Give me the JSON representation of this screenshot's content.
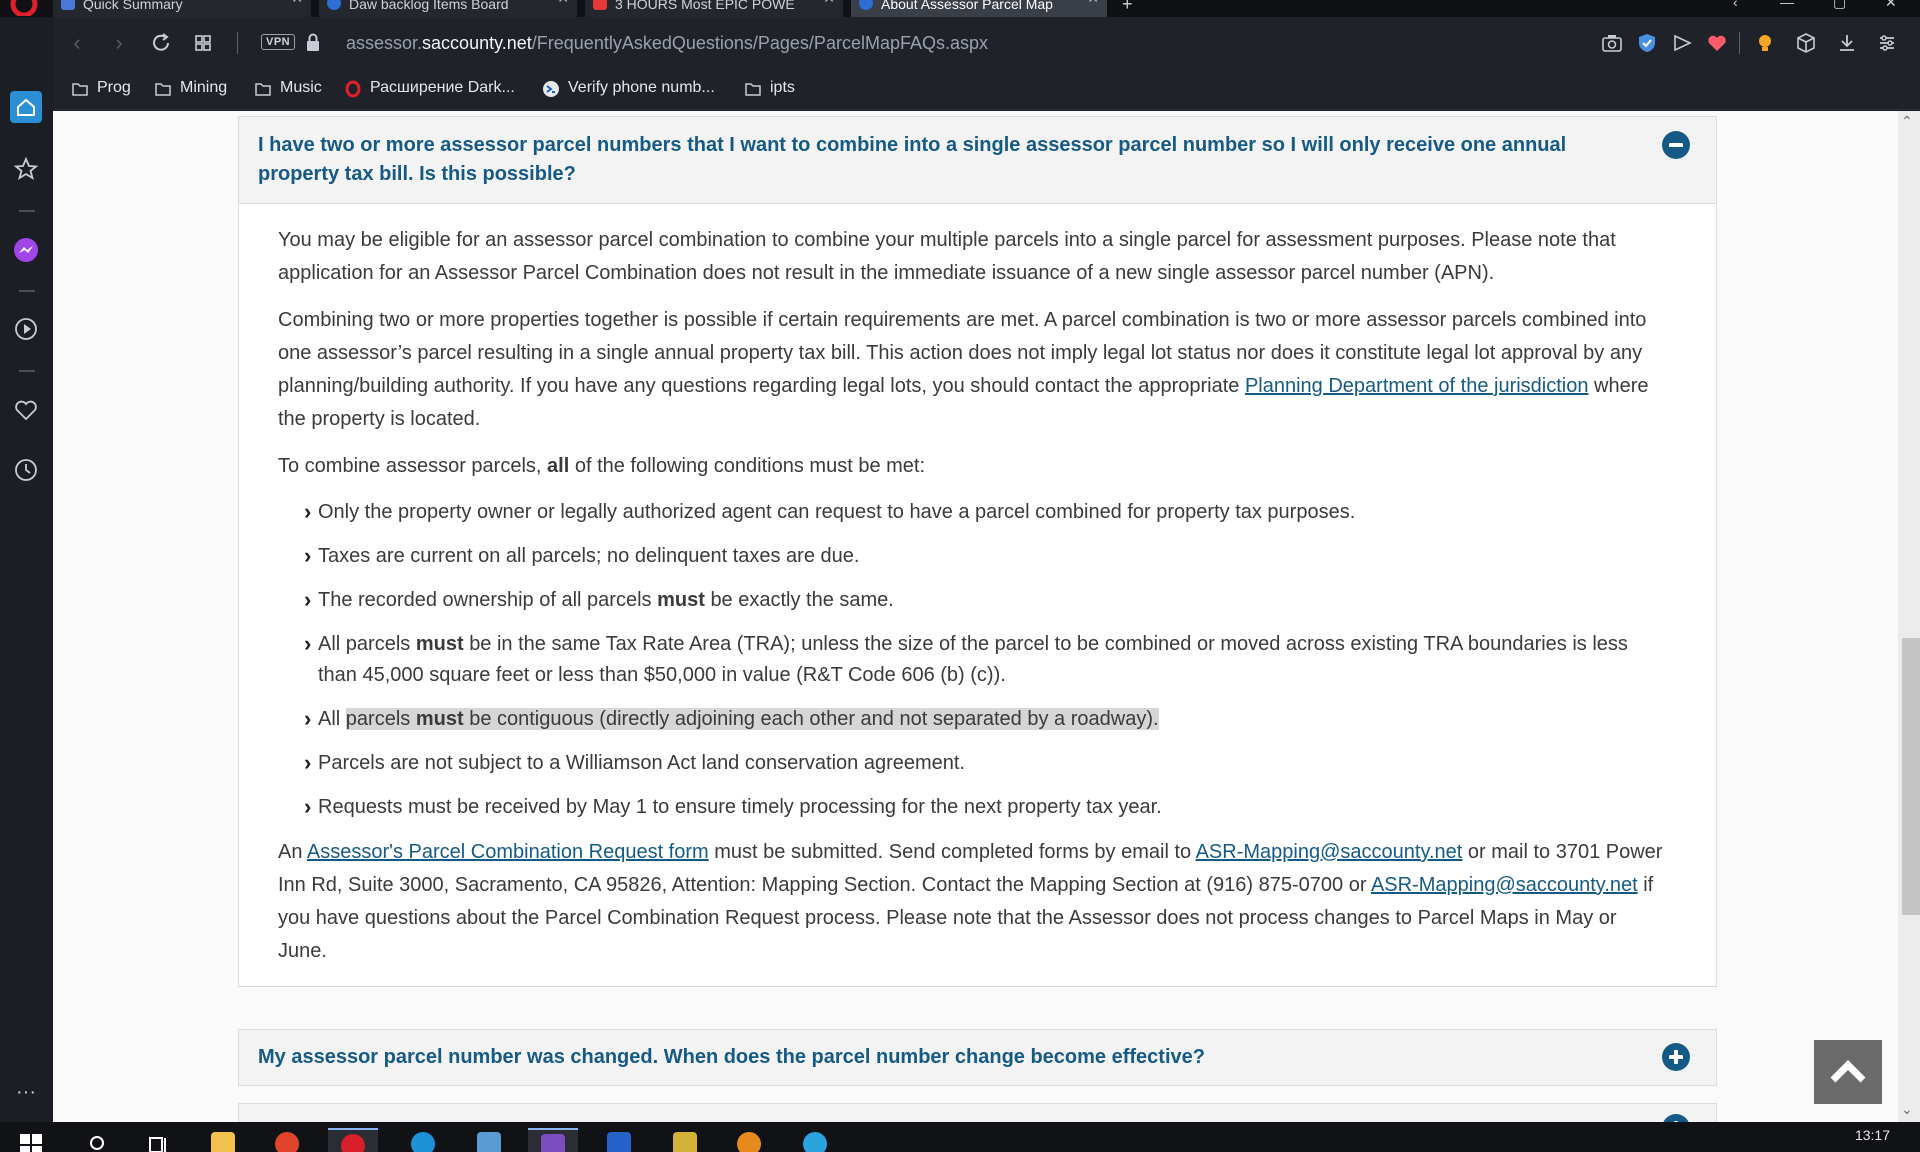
{
  "browser": {
    "tabs": [
      {
        "title": "Quick Summary",
        "active": false,
        "color": "#4a78d8"
      },
      {
        "title": "Daw backlog Items Board",
        "active": false,
        "color": "#2f6fd4"
      },
      {
        "title": "3 HOURS Most EPIC POWE",
        "active": false,
        "color": "#e53935"
      },
      {
        "title": "About Assessor Parcel Map",
        "active": true,
        "color": "#2f6fd4"
      }
    ],
    "url_prefix": "assessor.",
    "url_domain": "saccounty.net",
    "url_path": "/FrequentlyAskedQuestions/Pages/ParcelMapFAQs.aspx",
    "vpn_label": "VPN",
    "bookmarks": [
      {
        "label": "Prog",
        "icon": "folder-icon"
      },
      {
        "label": "Mining",
        "icon": "folder-icon"
      },
      {
        "label": "Music",
        "icon": "folder-icon"
      },
      {
        "label": "Расширение Dark...",
        "icon": "opera-icon"
      },
      {
        "label": "Verify phone numb...",
        "icon": "verify-icon"
      },
      {
        "label": "ipts",
        "icon": "folder-icon"
      }
    ]
  },
  "faq": {
    "open_question": "I have two or more assessor parcel numbers that I want to combine into a single assessor parcel number so I will only receive one annual property tax bill. Is this possible?",
    "p1": "You may be eligible for an assessor parcel combination to combine your multiple parcels into a single parcel for assessment purposes. Please note that application for an Assessor Parcel Combination does not result in the immediate issuance of a new single assessor parcel number (APN).",
    "p2_text": "Combining two or more properties together is possible if certain requirements are met. A parcel combination is two or more assessor parcels combined into one assessor’s parcel resulting in a single annual property tax bill. This action does not imply legal lot status nor does it constitute legal lot approval by any planning/building authority. If you have any questions regarding legal lots, you should contact the appropriate",
    "p2_link": "Planning Department of the jurisdiction",
    "p2_tail": "where the property is located.",
    "p3_pre": "To combine assessor parcels,",
    "p3_bold": "all",
    "p3_post": "of the following conditions must be met:",
    "c1": "Only the property owner or legally authorized agent can request to have a parcel combined for property tax purposes.",
    "c2": "Taxes are current on all parcels; no delinquent taxes are due.",
    "c3_pre": "The recorded ownership of all parcels",
    "c3_bold": "must",
    "c3_post": "be exactly the same.",
    "c4_pre": "All parcels",
    "c4_bold": "must",
    "c4_post": "be in the same Tax Rate Area (TRA); unless the size of the parcel to be combined or moved across existing TRA boundaries is less than 45,000 square feet or less than $50,000 in value (R&T Code 606 (b) (c)).",
    "c5_pre": "All",
    "c5_hl_pre": "parcels",
    "c5_bold": "must",
    "c5_hl_post": "be contiguous (directly adjoining each other and not separated by a roadway).",
    "c6": "Parcels are not subject to a Williamson Act land conservation agreement.",
    "c7": "Requests must be received by May 1 to ensure timely processing for the next property tax year.",
    "p4_pre": "An",
    "p4_link1": "Assessor's Parcel Combination Request form",
    "p4_mid1": "must be submitted.  Send completed forms by email to",
    "p4_link2": "ASR-Mapping@saccounty.net",
    "p4_mid2": "or mail to 3701 Power Inn Rd, Suite 3000, Sacramento, CA 95826, Attention: Mapping Section. Contact the Mapping Section at (916) 875-0700 or",
    "p4_link3": "ASR-Mapping@saccounty.net",
    "p4_tail": "if you have questions about the Parcel Combination Request process.  Please note that the Assessor does not process changes to Parcel Maps in May or June.",
    "next_question": "My assessor parcel number was changed. When does the parcel number change become effective?"
  },
  "taskbar": {
    "clock": "13:17"
  },
  "colors": {
    "accent": "#155a86",
    "page_bg": "#fafafa"
  }
}
